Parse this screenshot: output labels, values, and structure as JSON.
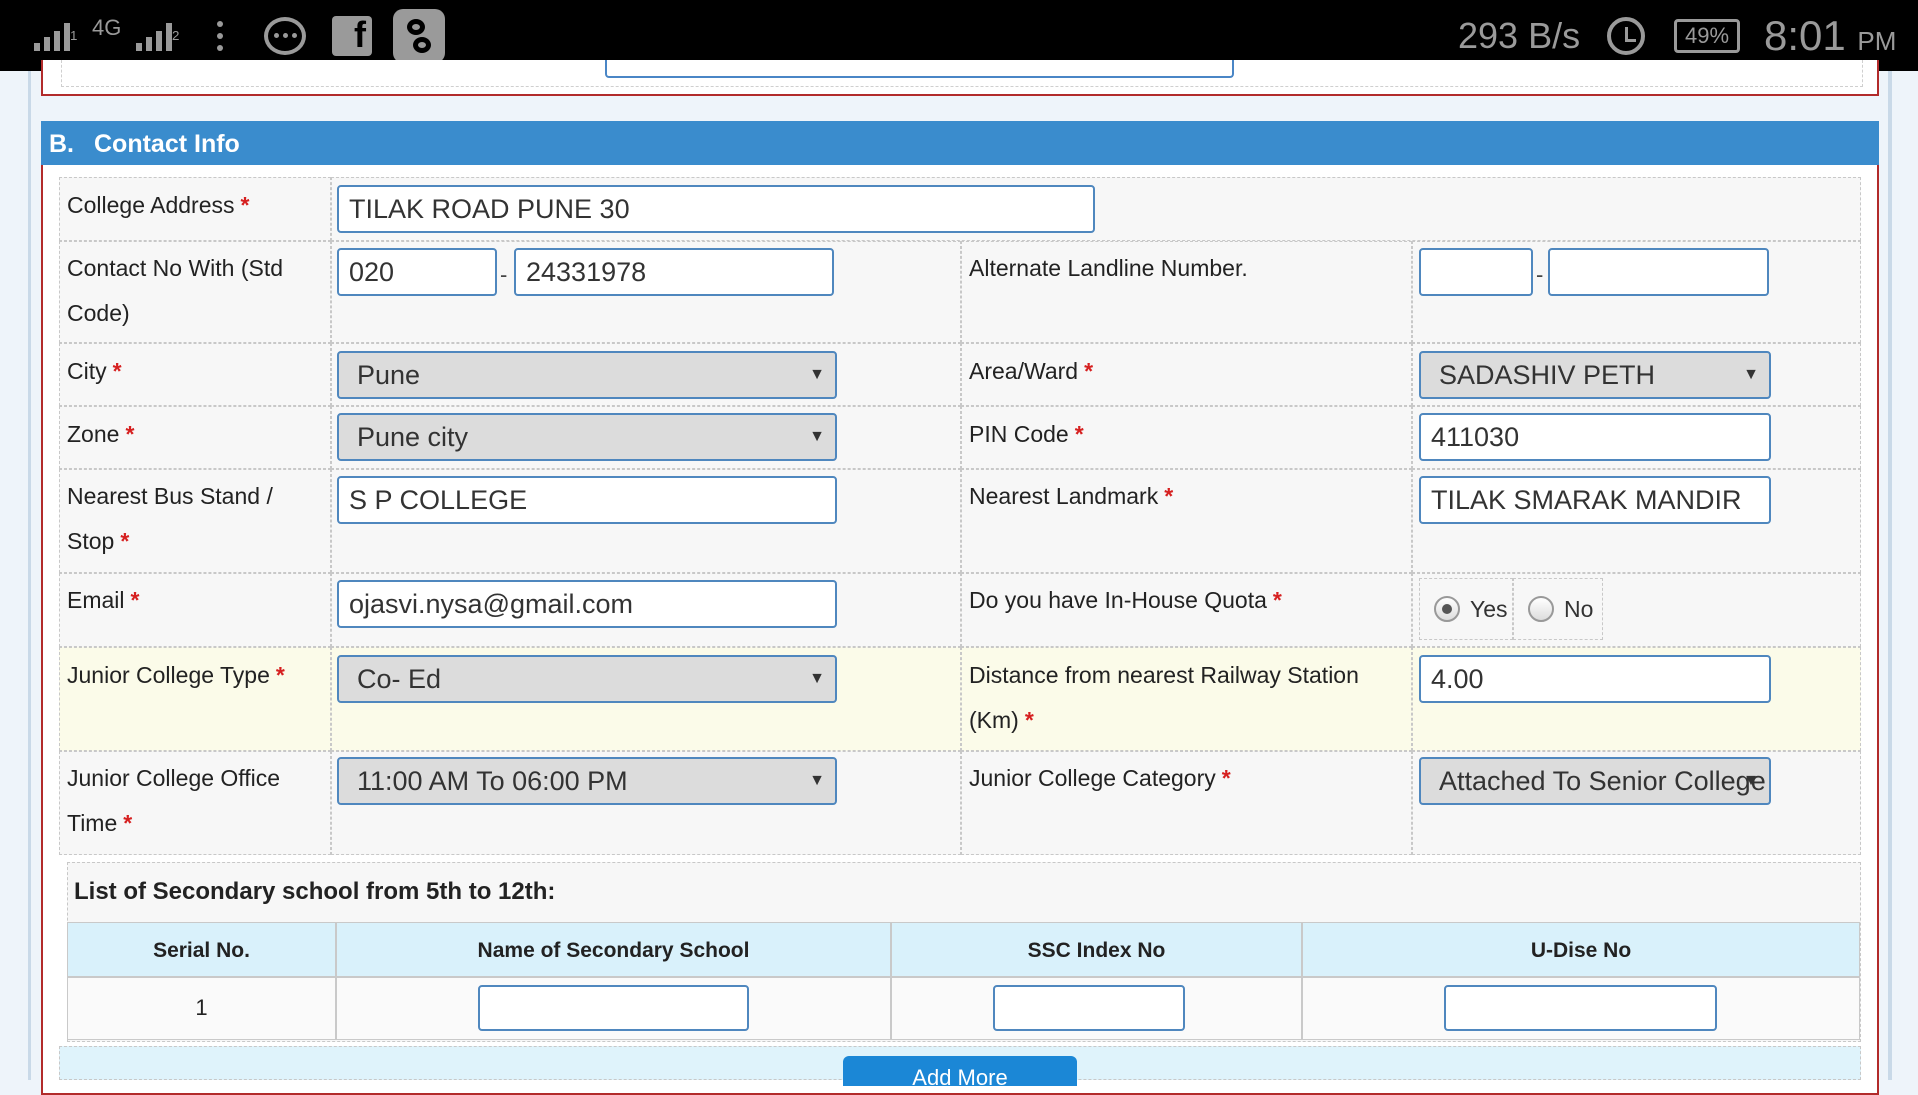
{
  "status_bar": {
    "network_label": "4G",
    "sim1": "1",
    "sim2": "2",
    "net_speed": "293 B/s",
    "battery": "49%",
    "time": "8:01",
    "ampm": "PM",
    "icons": [
      "signal-icon",
      "more-vert-icon",
      "chat-icon",
      "facebook-icon",
      "app-icon",
      "alarm-icon",
      "battery-icon"
    ]
  },
  "section": {
    "number": "B.",
    "title": "Contact Info"
  },
  "fields": {
    "college_address": {
      "label": "College Address",
      "required": "*",
      "value": "TILAK ROAD PUNE 30"
    },
    "contact_no": {
      "label_line1": "Contact No With (Std",
      "label_line2": "Code)",
      "std_code": "020",
      "separator": "-",
      "number": "24331978"
    },
    "alternate_landline": {
      "label": "Alternate Landline Number.",
      "std_code": "",
      "separator": "-",
      "number": ""
    },
    "city": {
      "label": "City",
      "required": "*",
      "selected": "Pune"
    },
    "area_ward": {
      "label": "Area/Ward",
      "required": "*",
      "selected": "SADASHIV PETH"
    },
    "zone": {
      "label": "Zone",
      "required": "*",
      "selected": "Pune city"
    },
    "pin_code": {
      "label": "PIN Code",
      "required": "*",
      "value": "411030"
    },
    "nearest_bus_stand": {
      "label_line1": "Nearest Bus Stand /",
      "label_line2": "Stop",
      "required": "*",
      "value": "S P COLLEGE"
    },
    "nearest_landmark": {
      "label": "Nearest Landmark",
      "required": "*",
      "value": "TILAK SMARAK MANDIR"
    },
    "email": {
      "label": "Email",
      "required": "*",
      "value": "ojasvi.nysa@gmail.com"
    },
    "in_house_quota": {
      "label": "Do you have In-House Quota",
      "required": "*",
      "option_yes": "Yes",
      "option_no": "No",
      "selected": "Yes"
    },
    "junior_college_type": {
      "label": "Junior College Type",
      "required": "*",
      "selected": "Co- Ed"
    },
    "distance_railway": {
      "label_line1": "Distance from nearest Railway Station",
      "label_line2": "(Km)",
      "required": "*",
      "value": "4.00"
    },
    "office_time": {
      "label_line1": "Junior College Office",
      "label_line2": "Time",
      "required": "*",
      "selected": "11:00 AM To 06:00 PM"
    },
    "college_category": {
      "label": "Junior College Category",
      "required": "*",
      "selected": "Attached To Senior College"
    }
  },
  "secondary_schools": {
    "title": "List of Secondary school from 5th to 12th:",
    "columns": [
      "Serial No.",
      "Name of Secondary School",
      "SSC Index No",
      "U-Dise No"
    ],
    "rows": [
      {
        "serial": "1",
        "name": "",
        "ssc_index": "",
        "udise": ""
      }
    ],
    "add_button_label": "Add More"
  },
  "colors": {
    "section_header": "#3a8ccd",
    "border_red": "#b22b2b",
    "input_border": "#4f87be",
    "required": "#d62020",
    "table_header": "#d9f1fb",
    "button": "#1b87d6"
  }
}
